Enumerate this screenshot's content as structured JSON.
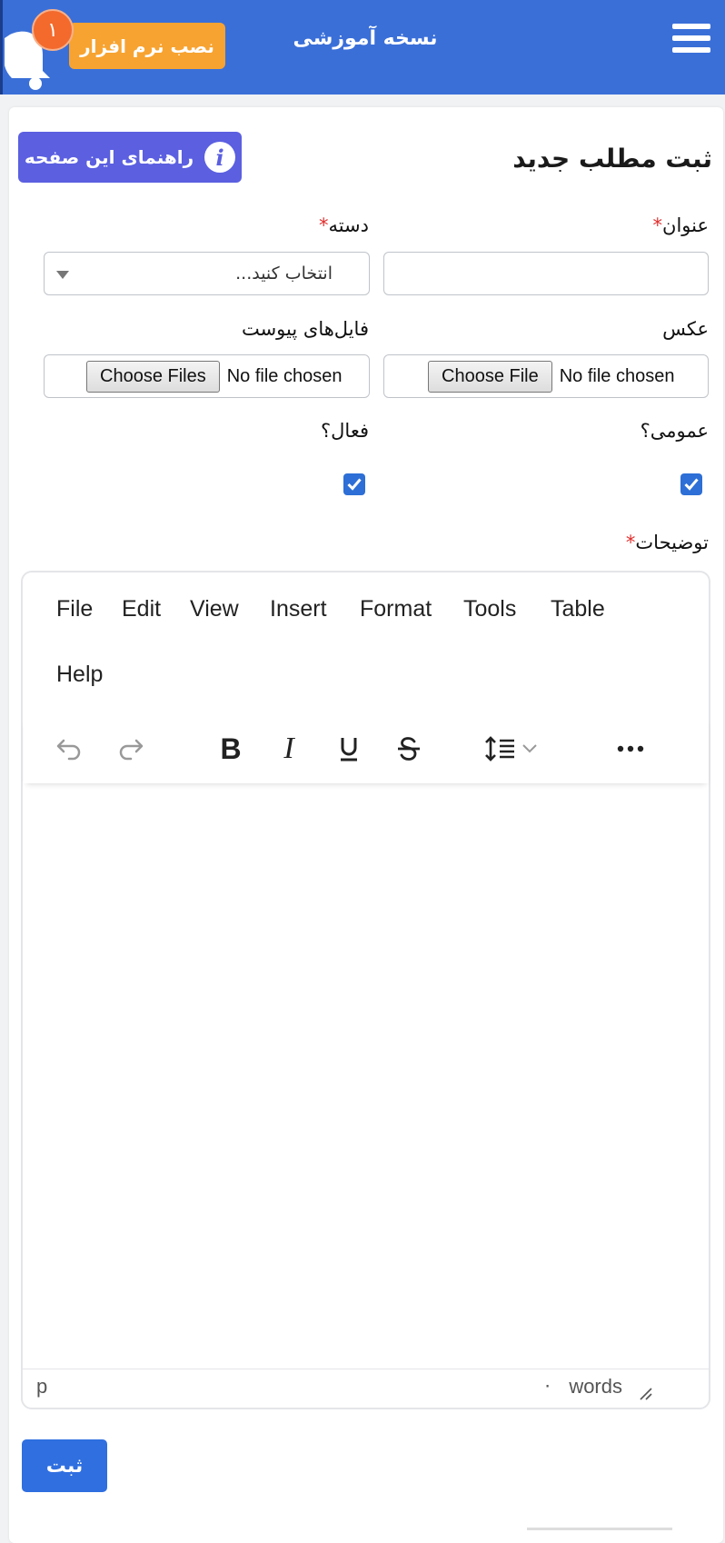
{
  "header": {
    "title": "نسخه آموزشی",
    "install_label": "نصب نرم افزار",
    "notification_count": "۱",
    "colors": {
      "bar": "#3a6fd8",
      "install": "#f7a331",
      "badge": "#f36a2c"
    }
  },
  "page": {
    "title": "ثبت مطلب جدید",
    "help_label": "راهنمای این صفحه",
    "help_icon": "info-icon",
    "help_color": "#5b5fe0"
  },
  "form": {
    "title_label": "عنوان",
    "category_label": "دسته",
    "required_mark": "*",
    "category_placeholder": "انتخاب کنید...",
    "image_label": "عکس",
    "attachments_label": "فایل‌های پیوست",
    "choose_file": "Choose File",
    "choose_files": "Choose Files",
    "no_file": "No file chosen",
    "public_label": "عمومی؟",
    "public_checked": true,
    "active_label": "فعال؟",
    "active_checked": true,
    "description_label": "توضیحات"
  },
  "editor": {
    "menu": [
      "File",
      "Edit",
      "View",
      "Insert",
      "Format",
      "Tools",
      "Table",
      "Help"
    ],
    "toolbar_icons": [
      "undo-icon",
      "redo-icon",
      "bold-icon",
      "italic-icon",
      "underline-icon",
      "strikethrough-icon",
      "line-height-icon",
      "more-icon"
    ],
    "status_path": "p",
    "word_count_value": "۰",
    "word_count_label": "words"
  },
  "submit_label": "ثبت"
}
